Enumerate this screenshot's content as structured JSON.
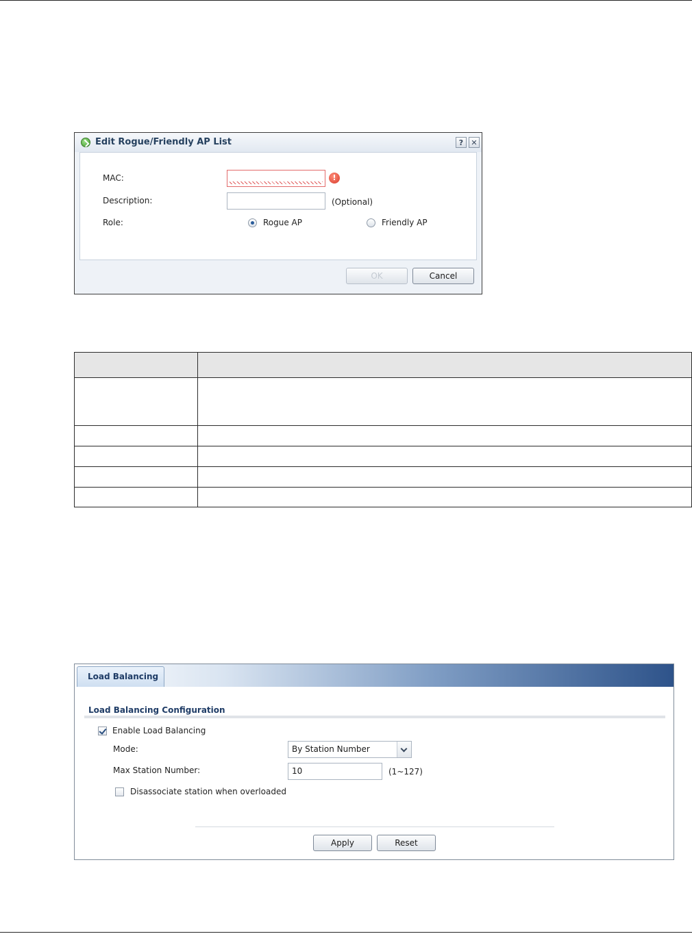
{
  "dialog": {
    "title": "Edit Rogue/Friendly AP List",
    "help_label": "?",
    "close_label": "✕",
    "mac_label": "MAC:",
    "mac_value": "",
    "error_symbol": "!",
    "description_label": "Description:",
    "description_value": "",
    "optional_hint": "(Optional)",
    "role_label": "Role:",
    "role_options": [
      "Rogue AP",
      "Friendly AP"
    ],
    "role_selected": "Rogue AP",
    "ok_label": "OK",
    "cancel_label": "Cancel"
  },
  "load_balancing": {
    "tab_label": "Load Balancing",
    "section_title": "Load Balancing Configuration",
    "enable_label": "Enable Load Balancing",
    "enable_checked": true,
    "mode_label": "Mode:",
    "mode_value": "By Station Number",
    "max_station_label": "Max Station Number:",
    "max_station_value": "10",
    "max_station_range": "(1~127)",
    "disassociate_label": "Disassociate station when overloaded",
    "disassociate_checked": false,
    "apply_label": "Apply",
    "reset_label": "Reset"
  },
  "colors": {
    "accent": "#1f3c66",
    "error": "#d73a2a",
    "tab_gradient_end": "#2e538a"
  },
  "icons": [
    "add-circle-icon",
    "help-icon",
    "close-icon",
    "error-icon",
    "chevron-down-icon"
  ]
}
